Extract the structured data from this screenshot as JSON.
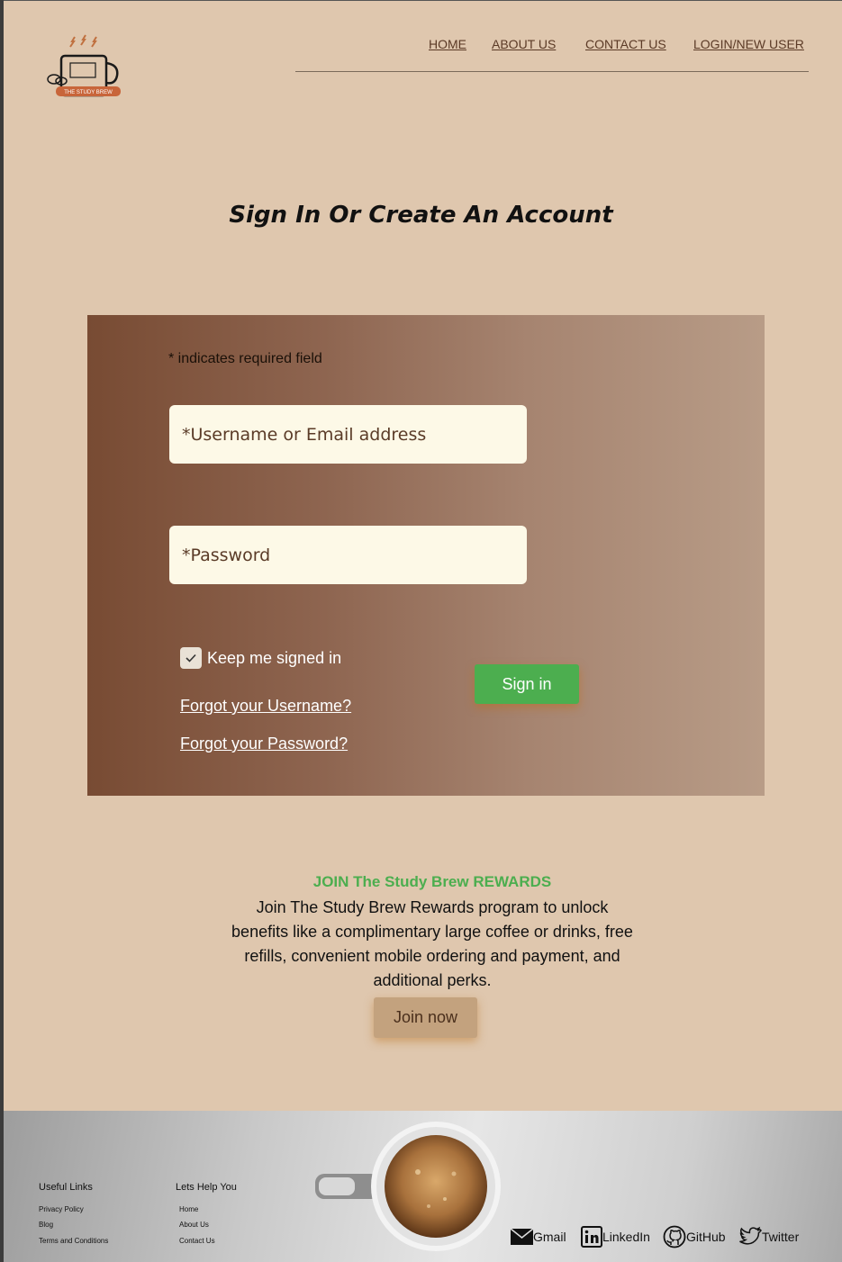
{
  "logo": {
    "text": "THE STUDY BREW",
    "icon": "coffee-cup-logo"
  },
  "nav": {
    "home": "HOME",
    "about": "ABOUT US",
    "contact": "CONTACT US",
    "login": "LOGIN/NEW USER"
  },
  "page_title": "Sign In Or Create An Account",
  "form": {
    "required_note": "* indicates required field",
    "username_placeholder": "*Username or Email address",
    "password_placeholder": "*Password",
    "keep_signed_in_label": "Keep me signed in",
    "keep_signed_in_checked": true,
    "forgot_username": "Forgot your Username?",
    "forgot_password": "Forgot your Password?",
    "signin_label": "Sign in"
  },
  "rewards": {
    "heading": "JOIN The Study Brew REWARDS",
    "body": "Join The Study Brew Rewards program to unlock benefits like a complimentary large coffee or drinks, free refills, convenient mobile ordering and payment, and additional perks.",
    "join_label": "Join now"
  },
  "footer": {
    "useful_links": {
      "heading": "Useful Links",
      "items": [
        "Privacy Policy",
        "Blog",
        "Terms and Conditions"
      ]
    },
    "help": {
      "heading": "Lets Help You",
      "items": [
        "Home",
        "About Us",
        "Contact Us"
      ]
    },
    "social": [
      {
        "label": "Gmail",
        "icon": "mail-icon"
      },
      {
        "label": "LinkedIn",
        "icon": "linkedin-icon"
      },
      {
        "label": "GitHub",
        "icon": "github-icon"
      },
      {
        "label": "Twitter",
        "icon": "twitter-icon"
      }
    ]
  },
  "colors": {
    "page_bg": "#dfc7ae",
    "accent_green": "#4cae4f",
    "panel_dark": "#784b33",
    "nav_text": "#5b3a26"
  }
}
